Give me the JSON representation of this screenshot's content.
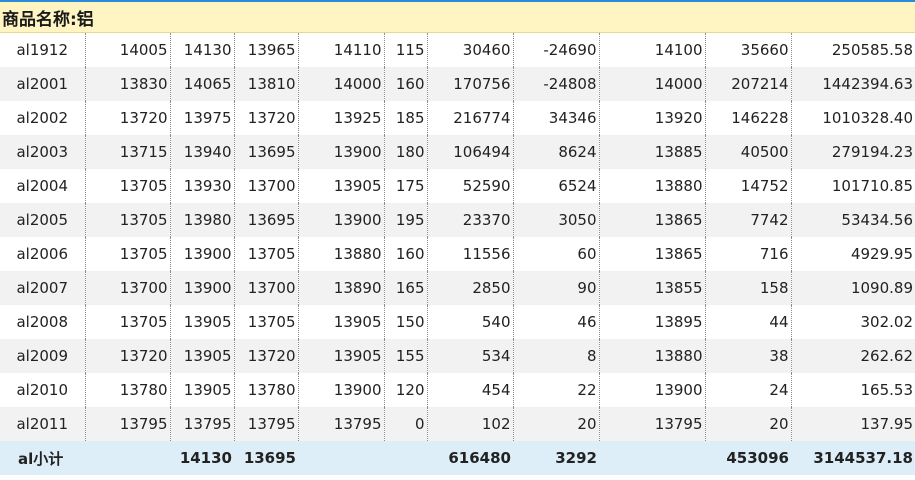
{
  "title": "商品名称:铝",
  "rows": [
    [
      "al1912",
      "14005",
      "14130",
      "13965",
      "14110",
      "115",
      "30460",
      "-24690",
      "14100",
      "35660",
      "250585.58"
    ],
    [
      "al2001",
      "13830",
      "14065",
      "13810",
      "14000",
      "160",
      "170756",
      "-24808",
      "14000",
      "207214",
      "1442394.63"
    ],
    [
      "al2002",
      "13720",
      "13975",
      "13720",
      "13925",
      "185",
      "216774",
      "34346",
      "13920",
      "146228",
      "1010328.40"
    ],
    [
      "al2003",
      "13715",
      "13940",
      "13695",
      "13900",
      "180",
      "106494",
      "8624",
      "13885",
      "40500",
      "279194.23"
    ],
    [
      "al2004",
      "13705",
      "13930",
      "13700",
      "13905",
      "175",
      "52590",
      "6524",
      "13880",
      "14752",
      "101710.85"
    ],
    [
      "al2005",
      "13705",
      "13980",
      "13695",
      "13900",
      "195",
      "23370",
      "3050",
      "13865",
      "7742",
      "53434.56"
    ],
    [
      "al2006",
      "13705",
      "13900",
      "13705",
      "13880",
      "160",
      "11556",
      "60",
      "13865",
      "716",
      "4929.95"
    ],
    [
      "al2007",
      "13700",
      "13900",
      "13700",
      "13890",
      "165",
      "2850",
      "90",
      "13855",
      "158",
      "1090.89"
    ],
    [
      "al2008",
      "13705",
      "13905",
      "13705",
      "13905",
      "150",
      "540",
      "46",
      "13895",
      "44",
      "302.02"
    ],
    [
      "al2009",
      "13720",
      "13905",
      "13720",
      "13905",
      "155",
      "534",
      "8",
      "13880",
      "38",
      "262.62"
    ],
    [
      "al2010",
      "13780",
      "13905",
      "13780",
      "13900",
      "120",
      "454",
      "22",
      "13900",
      "24",
      "165.53"
    ],
    [
      "al2011",
      "13795",
      "13795",
      "13795",
      "13795",
      "0",
      "102",
      "20",
      "13795",
      "20",
      "137.95"
    ]
  ],
  "total": [
    "al小计",
    "",
    "14130",
    "13695",
    "",
    "",
    "616480",
    "3292",
    "",
    "453096",
    "3144537.18"
  ]
}
